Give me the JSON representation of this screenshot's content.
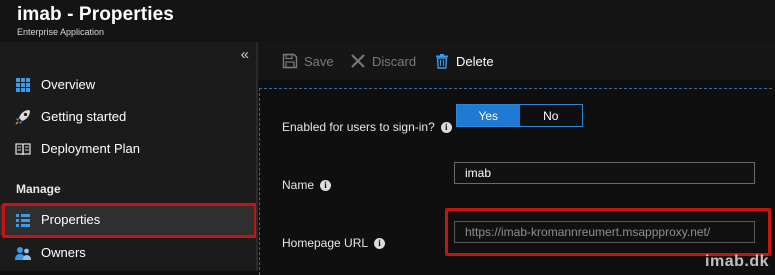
{
  "header": {
    "title": "imab - Properties",
    "subtitle": "Enterprise Application"
  },
  "sidebar": {
    "collapse_glyph": "«",
    "items": [
      {
        "label": "Overview",
        "icon": "grid-icon"
      },
      {
        "label": "Getting started",
        "icon": "rocket-icon"
      },
      {
        "label": "Deployment Plan",
        "icon": "book-icon"
      }
    ],
    "section_label": "Manage",
    "manage_items": [
      {
        "label": "Properties",
        "icon": "properties-icon",
        "active": true
      },
      {
        "label": "Owners",
        "icon": "owners-icon"
      }
    ]
  },
  "toolbar": {
    "save_label": "Save",
    "discard_label": "Discard",
    "delete_label": "Delete"
  },
  "form": {
    "enabled_label": "Enabled for users to sign-in?",
    "toggle": {
      "yes": "Yes",
      "no": "No",
      "selected": "Yes"
    },
    "name_label": "Name",
    "name_value": "imab",
    "homepage_label": "Homepage URL",
    "homepage_value": "https://imab-kromannreumert.msappproxy.net/"
  },
  "info_glyph": "i",
  "watermark": "imab.dk",
  "colors": {
    "accent": "#1f7ad4",
    "highlight": "#c41414",
    "background": "#0f0f0f"
  }
}
